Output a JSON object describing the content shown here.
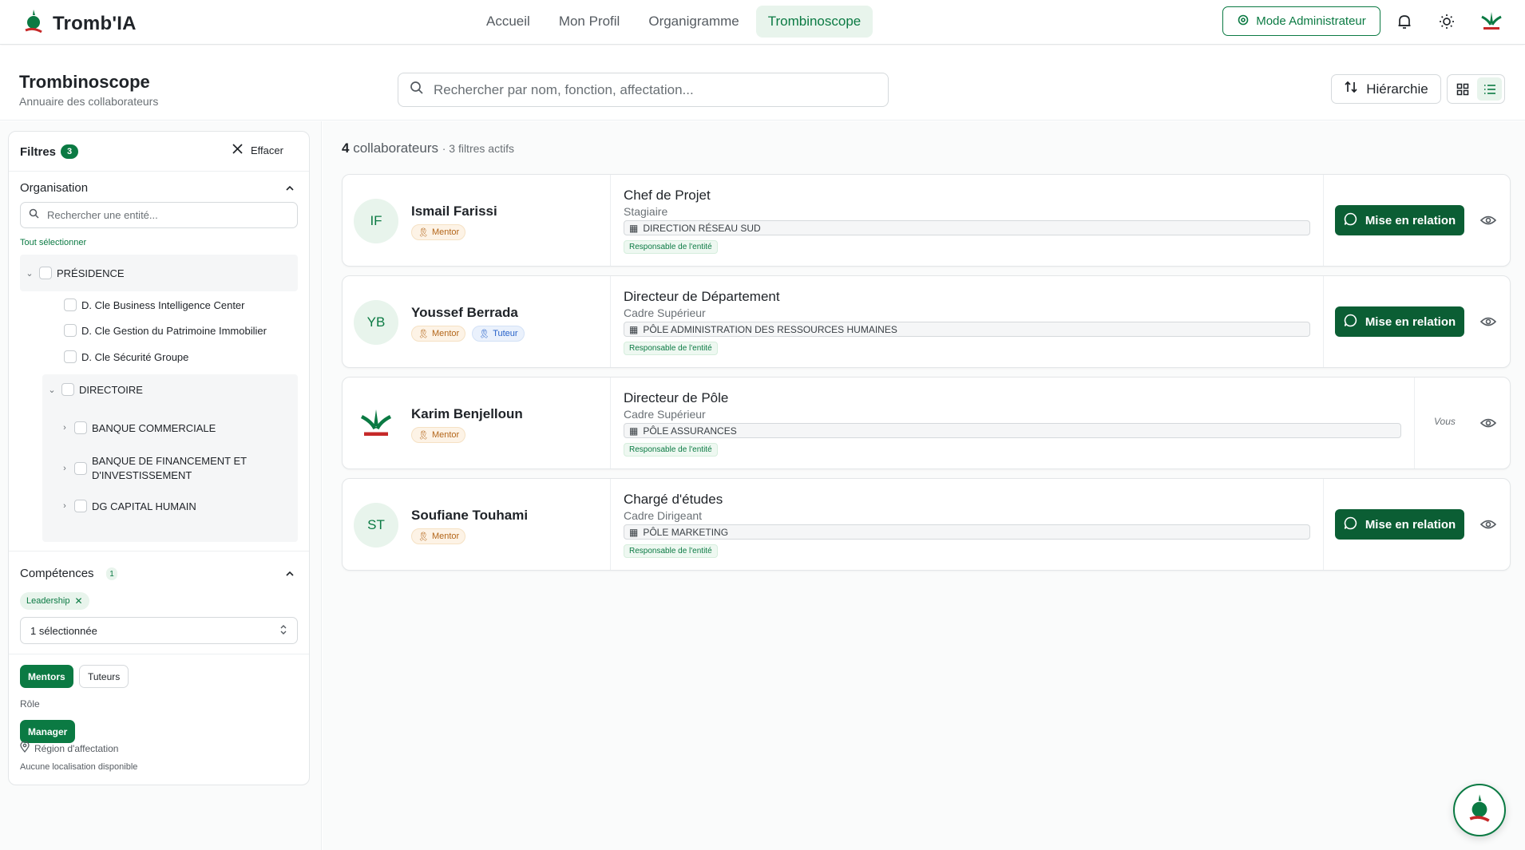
{
  "app": {
    "name": "Tromb'IA"
  },
  "nav": {
    "items": [
      "Accueil",
      "Mon Profil",
      "Organigramme",
      "Trombinoscope"
    ],
    "active": "Trombinoscope"
  },
  "topbar": {
    "admin_label": "Mode Administrateur"
  },
  "header": {
    "title": "Trombinoscope",
    "subtitle": "Annuaire des collaborateurs",
    "search_placeholder": "Rechercher par nom, fonction, affectation...",
    "hierarchy_label": "Hiérarchie"
  },
  "filters": {
    "title": "Filtres",
    "count": "3",
    "clear_label": "Effacer",
    "organisation": {
      "title": "Organisation",
      "search_placeholder": "Rechercher une entité...",
      "select_all": "Tout sélectionner",
      "tree": {
        "root": "PRÉSIDENCE",
        "children": [
          "D. Cle Business Intelligence Center",
          "D. Cle Gestion du Patrimoine Immobilier",
          "D. Cle Sécurité Groupe"
        ],
        "directoire": "DIRECTOIRE",
        "directoire_children": [
          "BANQUE COMMERCIALE",
          "BANQUE DE FINANCEMENT ET D'INVESTISSEMENT",
          "DG CAPITAL HUMAIN"
        ]
      }
    },
    "competences": {
      "title": "Compétences",
      "count": "1",
      "chip": "Leadership",
      "select_value": "1 sélectionnée"
    },
    "mentors_label": "Mentors",
    "tuteurs_label": "Tuteurs",
    "role": {
      "title": "Rôle",
      "value": "Manager"
    },
    "region": {
      "title": "Région d'affectation",
      "empty": "Aucune localisation disponible"
    }
  },
  "results": {
    "count": "4",
    "count_label": "collaborateurs",
    "filters_active": "· 3 filtres actifs"
  },
  "people": [
    {
      "initials": "IF",
      "name": "Ismail Farissi",
      "badges": [
        "Mentor"
      ],
      "role": "Chef de Projet",
      "level": "Stagiaire",
      "unit": "DIRECTION RÉSEAU SUD",
      "resp": "Responsable de l'entité",
      "contact": "Mise en relation"
    },
    {
      "initials": "YB",
      "name": "Youssef Berrada",
      "badges": [
        "Mentor",
        "Tuteur"
      ],
      "role": "Directeur de Département",
      "level": "Cadre Supérieur",
      "unit": "PÔLE ADMINISTRATION DES RESSOURCES HUMAINES",
      "resp": "Responsable de l'entité",
      "contact": "Mise en relation"
    },
    {
      "initials": "",
      "name": "Karim Benjelloun",
      "badges": [
        "Mentor"
      ],
      "role": "Directeur de Pôle",
      "level": "Cadre Supérieur",
      "unit": "PÔLE ASSURANCES",
      "resp": "Responsable de l'entité",
      "self_label": "Vous"
    },
    {
      "initials": "ST",
      "name": "Soufiane Touhami",
      "badges": [
        "Mentor"
      ],
      "role": "Chargé d'études",
      "level": "Cadre Dirigeant",
      "unit": "PÔLE MARKETING",
      "resp": "Responsable de l'entité",
      "contact": "Mise en relation"
    }
  ],
  "colors": {
    "brand": "#0b7a43",
    "brand_dark": "#0b5e34",
    "mentor": "#b3661a",
    "tuteur": "#2862c9"
  }
}
